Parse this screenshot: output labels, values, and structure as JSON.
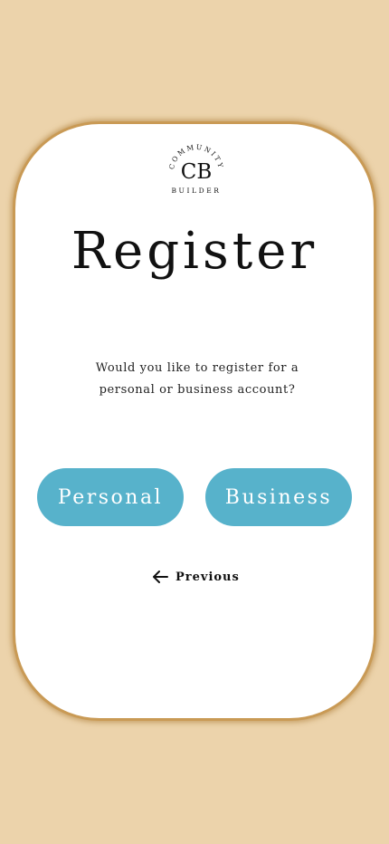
{
  "logo": {
    "initials": "CB",
    "arc_text": "COMMUNITY",
    "sub_text": "BUILDER"
  },
  "page": {
    "title": "Register",
    "question_line1": "Would you like to register for a",
    "question_line2": "personal or business account?"
  },
  "buttons": {
    "personal_label": "Personal",
    "business_label": "Business"
  },
  "nav": {
    "previous_label": "Previous",
    "previous_icon": "arrow-left-icon"
  },
  "colors": {
    "background": "#ecd3ab",
    "card_border": "#c99a55",
    "button": "#57b2cb"
  }
}
